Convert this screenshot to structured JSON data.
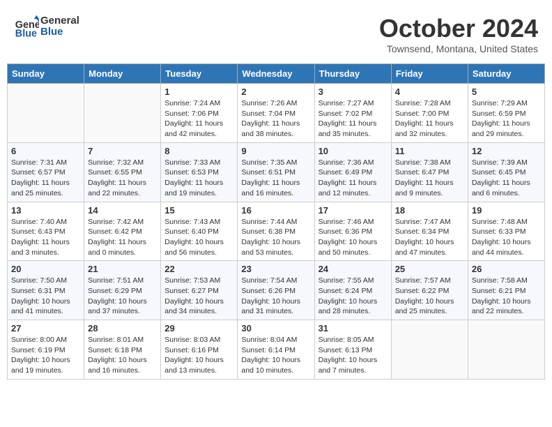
{
  "header": {
    "logo_line1": "General",
    "logo_line2": "Blue",
    "month": "October 2024",
    "location": "Townsend, Montana, United States"
  },
  "weekdays": [
    "Sunday",
    "Monday",
    "Tuesday",
    "Wednesday",
    "Thursday",
    "Friday",
    "Saturday"
  ],
  "weeks": [
    [
      {
        "day": "",
        "info": ""
      },
      {
        "day": "",
        "info": ""
      },
      {
        "day": "1",
        "info": "Sunrise: 7:24 AM\nSunset: 7:06 PM\nDaylight: 11 hours and 42 minutes."
      },
      {
        "day": "2",
        "info": "Sunrise: 7:26 AM\nSunset: 7:04 PM\nDaylight: 11 hours and 38 minutes."
      },
      {
        "day": "3",
        "info": "Sunrise: 7:27 AM\nSunset: 7:02 PM\nDaylight: 11 hours and 35 minutes."
      },
      {
        "day": "4",
        "info": "Sunrise: 7:28 AM\nSunset: 7:00 PM\nDaylight: 11 hours and 32 minutes."
      },
      {
        "day": "5",
        "info": "Sunrise: 7:29 AM\nSunset: 6:59 PM\nDaylight: 11 hours and 29 minutes."
      }
    ],
    [
      {
        "day": "6",
        "info": "Sunrise: 7:31 AM\nSunset: 6:57 PM\nDaylight: 11 hours and 25 minutes."
      },
      {
        "day": "7",
        "info": "Sunrise: 7:32 AM\nSunset: 6:55 PM\nDaylight: 11 hours and 22 minutes."
      },
      {
        "day": "8",
        "info": "Sunrise: 7:33 AM\nSunset: 6:53 PM\nDaylight: 11 hours and 19 minutes."
      },
      {
        "day": "9",
        "info": "Sunrise: 7:35 AM\nSunset: 6:51 PM\nDaylight: 11 hours and 16 minutes."
      },
      {
        "day": "10",
        "info": "Sunrise: 7:36 AM\nSunset: 6:49 PM\nDaylight: 11 hours and 12 minutes."
      },
      {
        "day": "11",
        "info": "Sunrise: 7:38 AM\nSunset: 6:47 PM\nDaylight: 11 hours and 9 minutes."
      },
      {
        "day": "12",
        "info": "Sunrise: 7:39 AM\nSunset: 6:45 PM\nDaylight: 11 hours and 6 minutes."
      }
    ],
    [
      {
        "day": "13",
        "info": "Sunrise: 7:40 AM\nSunset: 6:43 PM\nDaylight: 11 hours and 3 minutes."
      },
      {
        "day": "14",
        "info": "Sunrise: 7:42 AM\nSunset: 6:42 PM\nDaylight: 11 hours and 0 minutes."
      },
      {
        "day": "15",
        "info": "Sunrise: 7:43 AM\nSunset: 6:40 PM\nDaylight: 10 hours and 56 minutes."
      },
      {
        "day": "16",
        "info": "Sunrise: 7:44 AM\nSunset: 6:38 PM\nDaylight: 10 hours and 53 minutes."
      },
      {
        "day": "17",
        "info": "Sunrise: 7:46 AM\nSunset: 6:36 PM\nDaylight: 10 hours and 50 minutes."
      },
      {
        "day": "18",
        "info": "Sunrise: 7:47 AM\nSunset: 6:34 PM\nDaylight: 10 hours and 47 minutes."
      },
      {
        "day": "19",
        "info": "Sunrise: 7:48 AM\nSunset: 6:33 PM\nDaylight: 10 hours and 44 minutes."
      }
    ],
    [
      {
        "day": "20",
        "info": "Sunrise: 7:50 AM\nSunset: 6:31 PM\nDaylight: 10 hours and 41 minutes."
      },
      {
        "day": "21",
        "info": "Sunrise: 7:51 AM\nSunset: 6:29 PM\nDaylight: 10 hours and 37 minutes."
      },
      {
        "day": "22",
        "info": "Sunrise: 7:53 AM\nSunset: 6:27 PM\nDaylight: 10 hours and 34 minutes."
      },
      {
        "day": "23",
        "info": "Sunrise: 7:54 AM\nSunset: 6:26 PM\nDaylight: 10 hours and 31 minutes."
      },
      {
        "day": "24",
        "info": "Sunrise: 7:55 AM\nSunset: 6:24 PM\nDaylight: 10 hours and 28 minutes."
      },
      {
        "day": "25",
        "info": "Sunrise: 7:57 AM\nSunset: 6:22 PM\nDaylight: 10 hours and 25 minutes."
      },
      {
        "day": "26",
        "info": "Sunrise: 7:58 AM\nSunset: 6:21 PM\nDaylight: 10 hours and 22 minutes."
      }
    ],
    [
      {
        "day": "27",
        "info": "Sunrise: 8:00 AM\nSunset: 6:19 PM\nDaylight: 10 hours and 19 minutes."
      },
      {
        "day": "28",
        "info": "Sunrise: 8:01 AM\nSunset: 6:18 PM\nDaylight: 10 hours and 16 minutes."
      },
      {
        "day": "29",
        "info": "Sunrise: 8:03 AM\nSunset: 6:16 PM\nDaylight: 10 hours and 13 minutes."
      },
      {
        "day": "30",
        "info": "Sunrise: 8:04 AM\nSunset: 6:14 PM\nDaylight: 10 hours and 10 minutes."
      },
      {
        "day": "31",
        "info": "Sunrise: 8:05 AM\nSunset: 6:13 PM\nDaylight: 10 hours and 7 minutes."
      },
      {
        "day": "",
        "info": ""
      },
      {
        "day": "",
        "info": ""
      }
    ]
  ]
}
